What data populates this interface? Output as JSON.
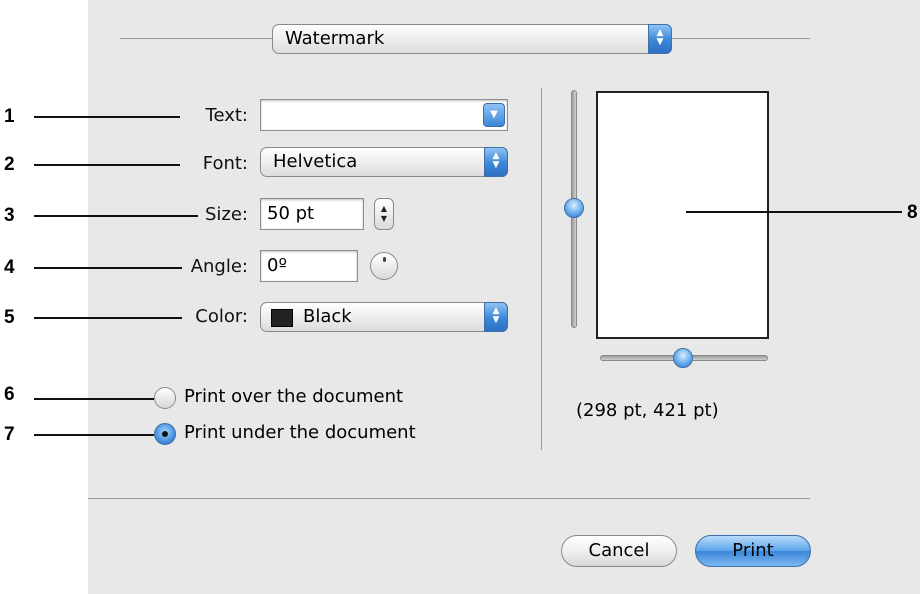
{
  "dialog": {
    "pane_selector": {
      "value": "Watermark"
    },
    "fields": {
      "text": {
        "label": "Text:",
        "value": ""
      },
      "font": {
        "label": "Font:",
        "value": "Helvetica"
      },
      "size": {
        "label": "Size:",
        "value": "50 pt"
      },
      "angle": {
        "label": "Angle:",
        "value": "0º"
      },
      "color": {
        "label": "Color:",
        "value": "Black",
        "swatch": "#222222"
      }
    },
    "options": [
      {
        "label": "Print over the document",
        "selected": false
      },
      {
        "label": "Print under the document",
        "selected": true
      }
    ],
    "preview": {
      "dimensions": "(298 pt, 421 pt)"
    },
    "buttons": {
      "cancel": "Cancel",
      "print": "Print"
    }
  },
  "callouts": [
    "1",
    "2",
    "3",
    "4",
    "5",
    "6",
    "7",
    "8"
  ],
  "colors": {
    "accent": "#3b86d8",
    "panel": "#e8e8e8"
  }
}
